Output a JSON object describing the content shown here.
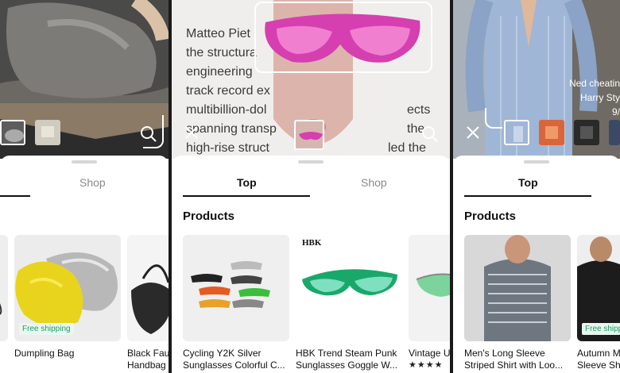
{
  "panel1": {
    "tabs": {
      "shop": "Shop"
    },
    "products": [
      {
        "title": "Dumpling Bag",
        "badge": "Free shipping"
      },
      {
        "title": "Black Fau",
        "title2": "Handbag"
      }
    ]
  },
  "panel2": {
    "background_text": [
      "Matteo Piet",
      "the structura",
      "engineering",
      "track record ex",
      "multibillion-dol",
      "spanning transp",
      "high-rise struct"
    ],
    "background_text_right": [
      "ects",
      "the",
      "led the"
    ],
    "tabs": {
      "top": "Top",
      "shop": "Shop"
    },
    "section_title": "Products",
    "products": [
      {
        "title": "Cycling Y2K Silver",
        "title2": "Sunglasses Colorful C..."
      },
      {
        "title": "HBK Trend Steam Punk",
        "title2": "Sunglasses Goggle W...",
        "brand": "HBK"
      },
      {
        "title": "Vintage U",
        "stars": "★★★★"
      }
    ]
  },
  "panel3": {
    "overlay_text": [
      "Ned cheatin",
      "Harry Sty",
      "9/"
    ],
    "tabs": {
      "top": "Top"
    },
    "section_title": "Products",
    "products": [
      {
        "title": "Men's Long Sleeve",
        "title2": "Striped Shirt with Loo..."
      },
      {
        "title": "Autumn M",
        "title2": "Sleeve Sh",
        "badge": "Free shipp"
      }
    ]
  },
  "icons": [
    "search-icon",
    "close-icon"
  ],
  "colors": {
    "accent": "#111111",
    "free_shipping": "#1b9e63",
    "free_shipping_bg": "#eaf7f1",
    "sunglasses_pink": "#d63fb0"
  }
}
